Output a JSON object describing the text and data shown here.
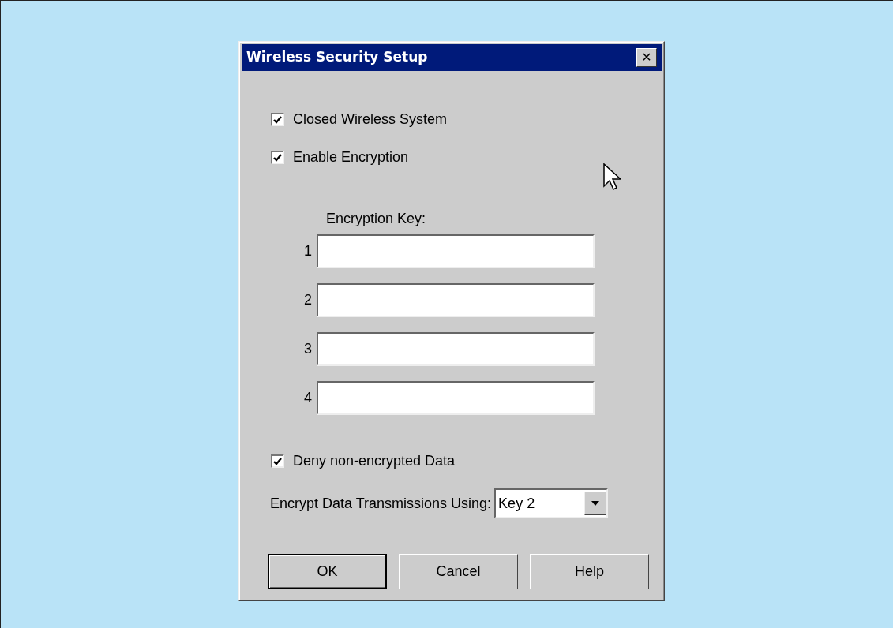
{
  "window": {
    "title": "Wireless Security Setup",
    "close": "✕"
  },
  "options": [
    {
      "label": "Closed Wireless System",
      "checked": true
    },
    {
      "label": "Enable Encryption",
      "checked": true
    }
  ],
  "encryption_keys": {
    "label": "Encryption Key:",
    "keys": [
      {
        "number": "1"
      },
      {
        "number": "2"
      },
      {
        "number": "3"
      },
      {
        "number": "4"
      }
    ]
  },
  "deny": {
    "label": "Deny non-encrypted Data",
    "checked": true
  },
  "transmit_key": {
    "label": "Encrypt Data Transmissions Using:",
    "value": "Key 2"
  },
  "buttons": [
    {
      "label": "OK",
      "default": true
    },
    {
      "label": "Cancel",
      "default": false
    },
    {
      "label": "Help",
      "default": false
    }
  ]
}
